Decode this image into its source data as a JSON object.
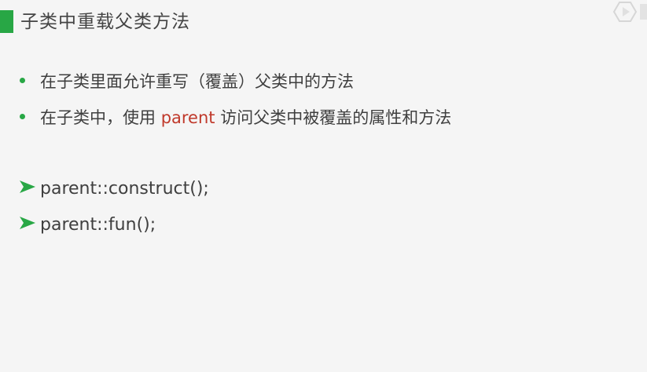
{
  "slide": {
    "title": "子类中重载父类方法",
    "accent_color": "#28a745",
    "bullets": [
      {
        "text": "在子类里面允许重写（覆盖）父类中的方法"
      },
      {
        "before": "在子类中，使用 ",
        "keyword": "parent",
        "after": " 访问父类中被覆盖的属性和方法"
      }
    ],
    "code_lines": [
      "parent::construct();",
      "parent::fun();"
    ],
    "keyword_color": "#c0392b"
  }
}
